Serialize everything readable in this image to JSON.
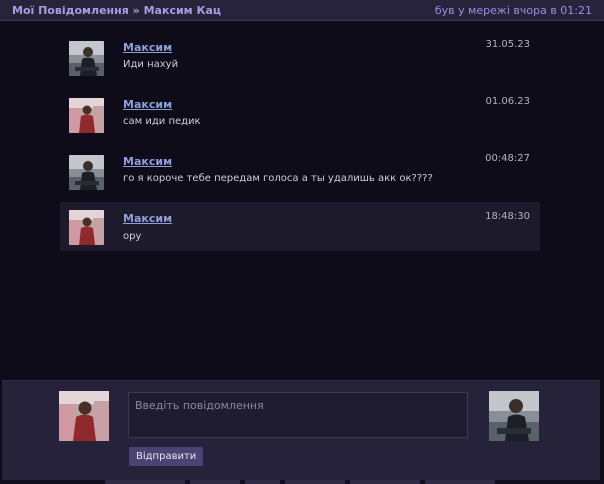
{
  "header": {
    "section": "Мої Повідомлення",
    "separator": "»",
    "contact": "Максим Кац",
    "last_seen": "був у мережі вчора в 01:21"
  },
  "messages": [
    {
      "author": "Максим",
      "text": "Иди нахуй",
      "time": "31.05.23",
      "avatar": "photo-man-dark",
      "highlight": false
    },
    {
      "author": "Максим",
      "text": "сам иди педик",
      "time": "01.06.23",
      "avatar": "photo-red-jacket",
      "highlight": false
    },
    {
      "author": "Максим",
      "text": "го я короче тебе передам голоса а ты удалишь акк ок????",
      "time": "00:48:27",
      "avatar": "photo-man-dark",
      "highlight": false
    },
    {
      "author": "Максим",
      "text": "ору",
      "time": "18:48:30",
      "avatar": "photo-red-jacket",
      "highlight": true
    }
  ],
  "composer": {
    "placeholder": "Введіть повідомлення",
    "value": "",
    "send_label": "Відправити"
  },
  "colors": {
    "accent": "#a99ce0",
    "author": "#8e9fd8",
    "background": "#0e0c19",
    "highlight": "#1c1a2b",
    "panel": "#25223a"
  }
}
